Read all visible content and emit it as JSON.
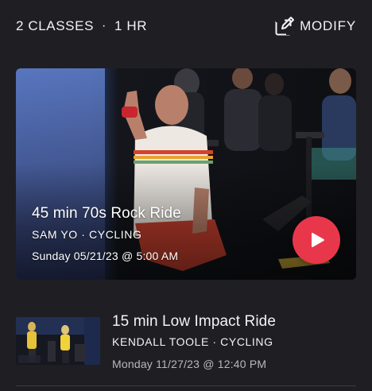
{
  "header": {
    "class_count": "2 CLASSES",
    "separator": "·",
    "duration": "1 HR",
    "modify_label": "MODIFY",
    "modify_icon": "edit-icon"
  },
  "featured_class": {
    "title": "45 min 70s Rock Ride",
    "instructor_discipline": "SAM YO · CYCLING",
    "schedule": "Sunday 05/21/23 @ 5:00 AM",
    "play_icon": "play-icon",
    "accent_color": "#e8374b"
  },
  "classes": [
    {
      "title": "15 min Low Impact Ride",
      "instructor_discipline": "KENDALL TOOLE · CYCLING",
      "schedule": "Monday 11/27/23 @ 12:40 PM"
    }
  ]
}
